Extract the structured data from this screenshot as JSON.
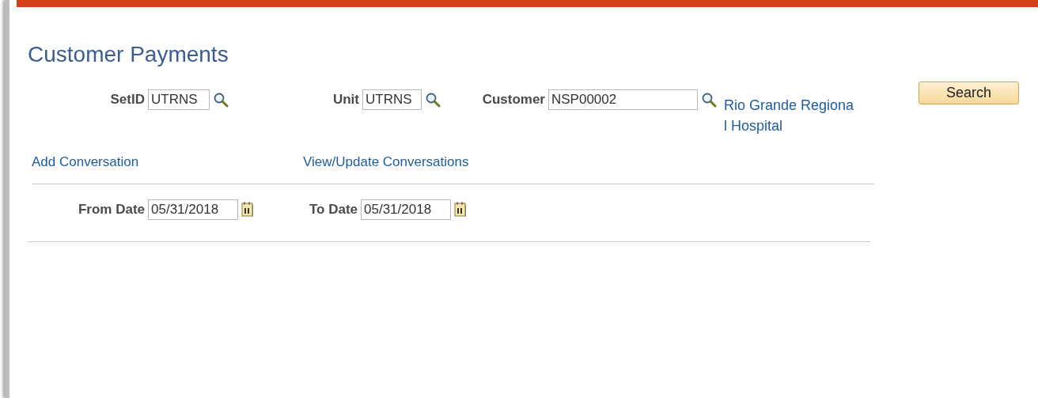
{
  "page_title": "Customer Payments",
  "criteria": [
    {
      "label": "SetID",
      "value": "UTRNS",
      "kind": "lookup"
    },
    {
      "label": "Unit",
      "value": "UTRNS",
      "kind": "lookup"
    },
    {
      "label": "Customer",
      "value": "NSP00002",
      "kind": "lookup"
    }
  ],
  "customer_description": "Rio Grande Regional Hospital",
  "search_button": "Search",
  "links": [
    "Add Conversation",
    "View/Update Conversations"
  ],
  "dates": [
    {
      "label": "From Date",
      "value": "05/31/2018",
      "kind": "date"
    },
    {
      "label": "To Date",
      "value": "05/31/2018",
      "kind": "date"
    }
  ]
}
